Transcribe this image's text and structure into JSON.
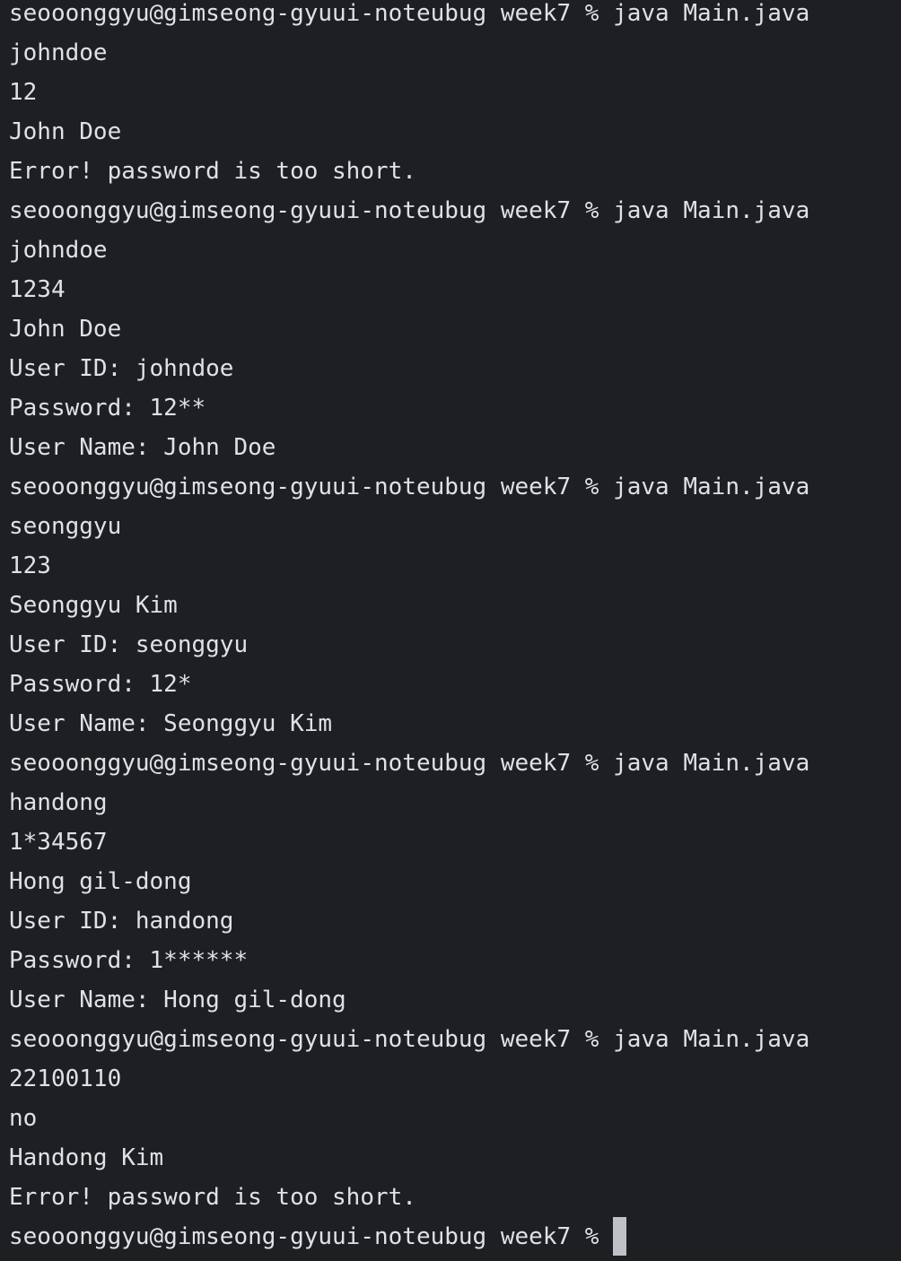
{
  "terminal": {
    "lines": [
      "seooonggyu@gimseong-gyuui-noteubug week7 % java Main.java",
      "johndoe",
      "12",
      "John Doe",
      "Error! password is too short.",
      "seooonggyu@gimseong-gyuui-noteubug week7 % java Main.java",
      "johndoe",
      "1234",
      "John Doe",
      "User ID: johndoe",
      "Password: 12**",
      "User Name: John Doe",
      "seooonggyu@gimseong-gyuui-noteubug week7 % java Main.java",
      "seonggyu",
      "123",
      "Seonggyu Kim",
      "User ID: seonggyu",
      "Password: 12*",
      "User Name: Seonggyu Kim",
      "seooonggyu@gimseong-gyuui-noteubug week7 % java Main.java",
      "handong",
      "1*34567",
      "Hong gil-dong",
      "User ID: handong",
      "Password: 1******",
      "User Name: Hong gil-dong",
      "seooonggyu@gimseong-gyuui-noteubug week7 % java Main.java",
      "22100110",
      "no",
      "Handong Kim",
      "Error! password is too short."
    ],
    "prompt": "seooonggyu@gimseong-gyuui-noteubug week7 %"
  }
}
